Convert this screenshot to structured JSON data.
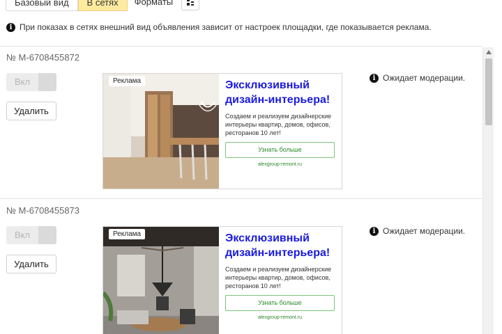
{
  "tabs": [
    {
      "label": "Базовый вид"
    },
    {
      "label": "В сетях"
    },
    {
      "label": "Форматы"
    }
  ],
  "notice": "При показах в сетях внешний вид объявления зависит от настроек площадки, где показывается реклама.",
  "cards": [
    {
      "number": "№ M-6708455872",
      "toggle_label": "Вкл",
      "delete_label": "Удалить",
      "ad_tag": "Реклама",
      "ad_title": "Эксклюзивный дизайн-интерьера!",
      "ad_text": "Создаем и реализуем дизайнерские интерьеры квартир, домов, офисов, ресторанов 10 лет!",
      "ad_cta": "Узнать больше",
      "ad_domain": "alexgroup-remont.ru",
      "status": "Ожидает модерации."
    },
    {
      "number": "№ M-6708455873",
      "toggle_label": "Вкл",
      "delete_label": "Удалить",
      "ad_tag": "Реклама",
      "ad_title": "Эксклюзивный дизайн-интерьера!",
      "ad_text": "Создаем и реализуем дизайнерские интерьеры квартир, домов, офисов, ресторанов 10 лет!",
      "ad_cta": "Узнать больше",
      "ad_domain": "alexgroup-remont.ru",
      "status": "Ожидает модерации."
    }
  ],
  "colors": {
    "active_tab": "#ffeba0",
    "ad_title": "#1a1ae0",
    "ad_cta": "#2a8a2a"
  },
  "icons": [
    "grid-icon",
    "info-icon",
    "scroll-up-arrow-icon"
  ]
}
